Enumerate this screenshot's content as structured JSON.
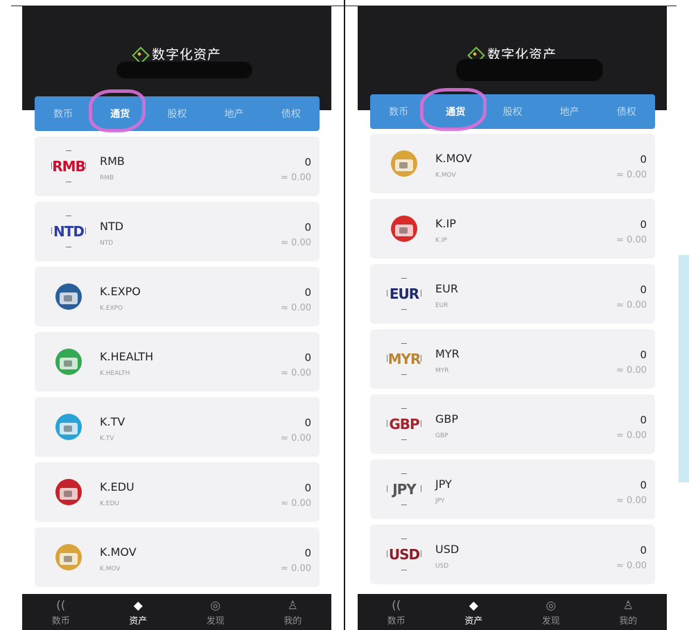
{
  "app_title": "数字化资产",
  "tabs": [
    "数币",
    "通货",
    "股权",
    "地产",
    "债权"
  ],
  "active_tab": "通货",
  "bottom_nav": [
    {
      "label": "数币",
      "icon": "coin-icon"
    },
    {
      "label": "资产",
      "icon": "layers-icon",
      "active": true
    },
    {
      "label": "发现",
      "icon": "discover-icon"
    },
    {
      "label": "我的",
      "icon": "person-icon"
    }
  ],
  "left_list": [
    {
      "name": "RMB",
      "sub": "RMB",
      "amount": "0",
      "approx": "≈ 0.00",
      "icon_text": "RMB",
      "icon_color": "#c8102e"
    },
    {
      "name": "NTD",
      "sub": "NTD",
      "amount": "0",
      "approx": "≈ 0.00",
      "icon_text": "NTD",
      "icon_color": "#2b3ea1"
    },
    {
      "name": "K.EXPO",
      "sub": "K.EXPO",
      "amount": "0",
      "approx": "≈ 0.00",
      "badge_color": "#2a5f9e"
    },
    {
      "name": "K.HEALTH",
      "sub": "K.HEALTH",
      "amount": "0",
      "approx": "≈ 0.00",
      "badge_color": "#34a853"
    },
    {
      "name": "K.TV",
      "sub": "K.TV",
      "amount": "0",
      "approx": "≈ 0.00",
      "badge_color": "#29a3d6"
    },
    {
      "name": "K.EDU",
      "sub": "K.EDU",
      "amount": "0",
      "approx": "≈ 0.00",
      "badge_color": "#c4232b"
    },
    {
      "name": "K.MOV",
      "sub": "K.MOV",
      "amount": "0",
      "approx": "≈ 0.00",
      "badge_color": "#d9a43a"
    }
  ],
  "right_list": [
    {
      "name": "K.MOV",
      "sub": "K.MOV",
      "amount": "0",
      "approx": "≈ 0.00",
      "badge_color": "#d9a43a"
    },
    {
      "name": "K.IP",
      "sub": "K.IP",
      "amount": "0",
      "approx": "≈ 0.00",
      "badge_color": "#d82b2b"
    },
    {
      "name": "EUR",
      "sub": "EUR",
      "amount": "0",
      "approx": "≈ 0.00",
      "icon_text": "EUR",
      "icon_color": "#1f2a6b"
    },
    {
      "name": "MYR",
      "sub": "MYR",
      "amount": "0",
      "approx": "≈ 0.00",
      "icon_text": "MYR",
      "icon_color": "#b8863a"
    },
    {
      "name": "GBP",
      "sub": "GBP",
      "amount": "0",
      "approx": "≈ 0.00",
      "icon_text": "GBP",
      "icon_color": "#a3232f"
    },
    {
      "name": "JPY",
      "sub": "JPY",
      "amount": "0",
      "approx": "≈ 0.00",
      "icon_text": "JPY",
      "icon_color": "#555555"
    },
    {
      "name": "USD",
      "sub": "USD",
      "amount": "0",
      "approx": "≈ 0.00",
      "icon_text": "USD",
      "icon_color": "#8a1f2a"
    }
  ],
  "colors": {
    "tab_bar": "#3f8ed6",
    "header": "#1c1c1e",
    "highlight": "#d96fd7"
  }
}
